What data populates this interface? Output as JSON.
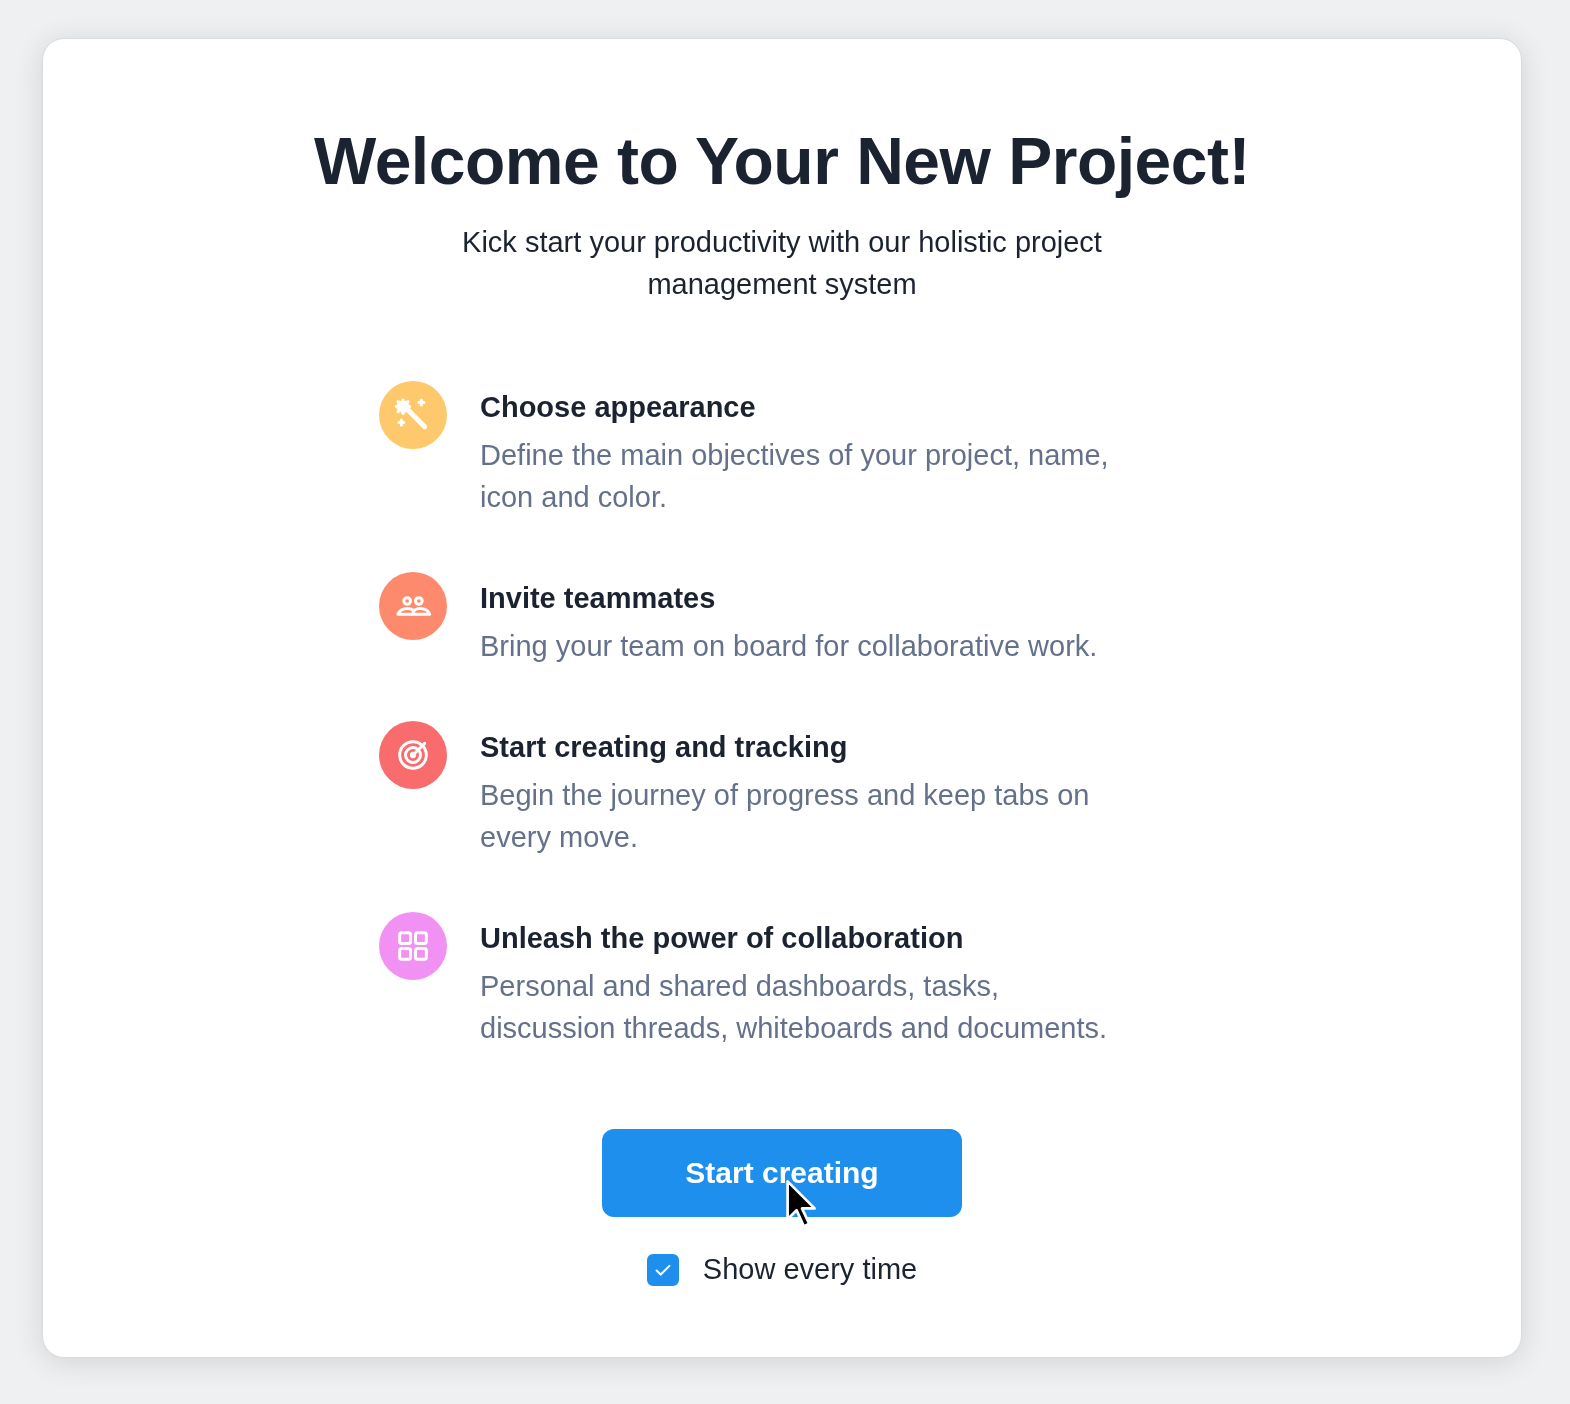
{
  "dialog": {
    "title": "Welcome to Your New Project!",
    "subtitle": "Kick start your productivity with our holistic project management system",
    "features": [
      {
        "kind": "wand",
        "color": "#fec96c",
        "title": "Choose appearance",
        "description": "Define the main objectives of your project, name, icon and color."
      },
      {
        "kind": "people",
        "color": "#fd8a6c",
        "title": "Invite teammates",
        "description": "Bring your team on board for collaborative work."
      },
      {
        "kind": "target",
        "color": "#f86c6e",
        "title": "Start creating and tracking",
        "description": "Begin the journey of progress and keep tabs on every move."
      },
      {
        "kind": "grid",
        "color": "#f291f4",
        "title": "Unleash the power of collaboration",
        "description": "Personal and shared dashboards, tasks, discussion threads, whiteboards and documents."
      }
    ],
    "primary_button": "Start creating",
    "show_every_time": {
      "label": "Show every time",
      "checked": true
    }
  }
}
